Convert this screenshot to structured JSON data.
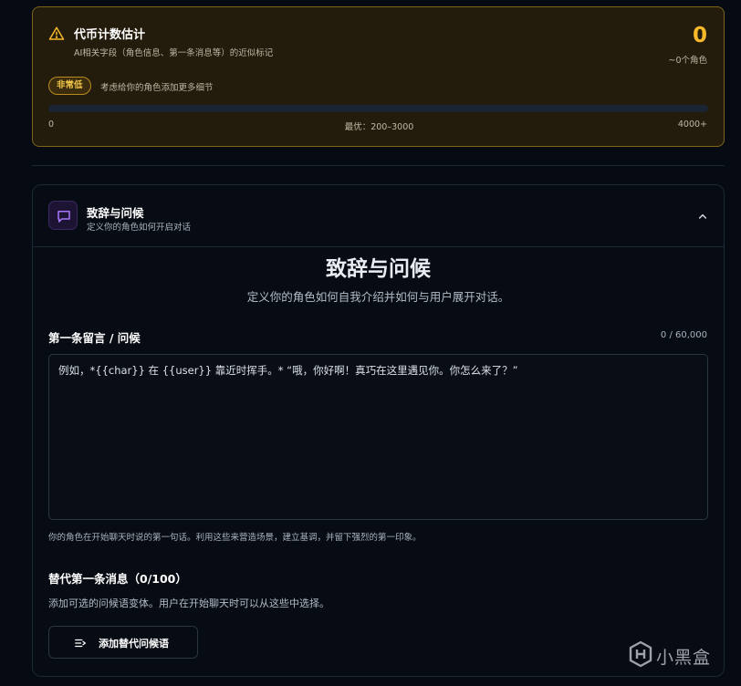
{
  "token_estimate": {
    "title": "代币计数估计",
    "subtitle": "AI相关字段（角色信息、第一条消息等）的近似标记",
    "count": "0",
    "count_unit": "~0个角色",
    "level_badge": "非常低",
    "level_hint": "考虑给你的角色添加更多细节",
    "progress": 0,
    "scale_min": "0",
    "scale_optimal": "最优：200–3000",
    "scale_max": "4000+",
    "accent_color": "#f5b92a"
  },
  "greeting_section": {
    "header_title": "致辞与问候",
    "header_subtitle": "定义你的角色如何开启对话",
    "title": "致辞与问候",
    "subtitle": "定义你的角色如何自我介绍并如何与用户展开对话。",
    "first_message": {
      "label": "第一条留言 / 问候",
      "counter": "0 / 60,000",
      "placeholder": "例如，*{{char}} 在 {{user}} 靠近时挥手。* “哦，你好啊！真巧在这里遇见你。你怎么来了？”",
      "help": "你的角色在开始聊天时说的第一句话。利用这些来营造场景，建立基调，并留下强烈的第一印象。"
    },
    "alternate": {
      "title": "替代第一条消息（0/100）",
      "description": "添加可选的问候语变体。用户在开始聊天时可以从这些中选择。",
      "add_button_label": "添加替代问候语"
    }
  },
  "watermark": {
    "text": "小黑盒"
  },
  "icons": {
    "warning": "warning-triangle-icon",
    "chat": "chat-bubble-icon",
    "collapse": "chevron-up-icon",
    "add": "add-list-icon"
  }
}
